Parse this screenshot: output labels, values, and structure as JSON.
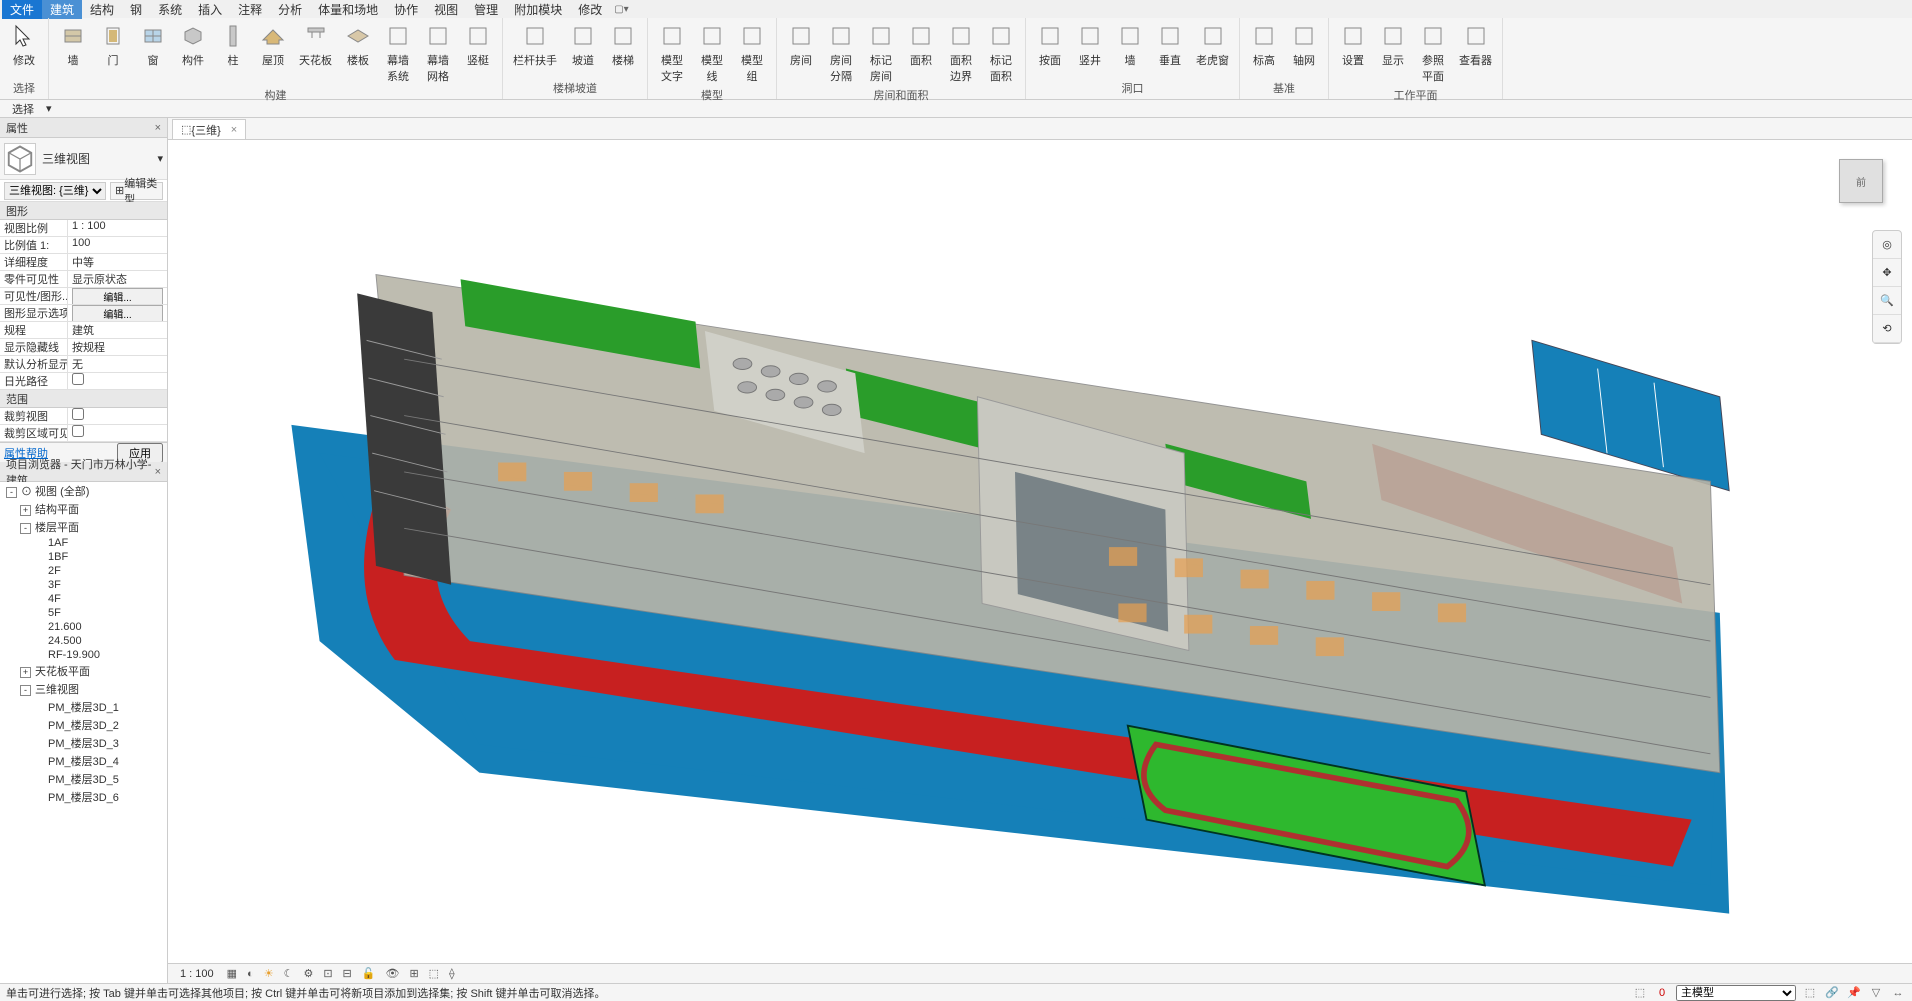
{
  "menu": {
    "items": [
      "文件",
      "建筑",
      "结构",
      "钢",
      "系统",
      "插入",
      "注释",
      "分析",
      "体量和场地",
      "协作",
      "视图",
      "管理",
      "附加模块",
      "修改"
    ],
    "active_index": 1
  },
  "ribbon": {
    "groups": [
      {
        "label": "选择",
        "tools": [
          {
            "icon": "cursor",
            "label": "修改"
          }
        ]
      },
      {
        "label": "构建",
        "tools": [
          {
            "icon": "wall",
            "label": "墙"
          },
          {
            "icon": "door",
            "label": "门"
          },
          {
            "icon": "window",
            "label": "窗"
          },
          {
            "icon": "component",
            "label": "构件"
          },
          {
            "icon": "column",
            "label": "柱"
          },
          {
            "icon": "roof",
            "label": "屋顶"
          },
          {
            "icon": "ceiling",
            "label": "天花板"
          },
          {
            "icon": "floor",
            "label": "楼板"
          },
          {
            "icon": "curtain-sys",
            "label": "幕墙\n系统"
          },
          {
            "icon": "curtain-grid",
            "label": "幕墙\n网格"
          },
          {
            "icon": "mullion",
            "label": "竖梃"
          }
        ]
      },
      {
        "label": "楼梯坡道",
        "tools": [
          {
            "icon": "railing",
            "label": "栏杆扶手"
          },
          {
            "icon": "ramp",
            "label": "坡道"
          },
          {
            "icon": "stair",
            "label": "楼梯"
          }
        ]
      },
      {
        "label": "模型",
        "tools": [
          {
            "icon": "text",
            "label": "模型\n文字"
          },
          {
            "icon": "line",
            "label": "模型\n线"
          },
          {
            "icon": "group",
            "label": "模型\n组"
          }
        ]
      },
      {
        "label": "房间和面积",
        "tools": [
          {
            "icon": "room",
            "label": "房间"
          },
          {
            "icon": "room-sep",
            "label": "房间\n分隔"
          },
          {
            "icon": "tag-room",
            "label": "标记\n房间"
          },
          {
            "icon": "area",
            "label": "面积"
          },
          {
            "icon": "area-bound",
            "label": "面积\n边界"
          },
          {
            "icon": "tag-area",
            "label": "标记\n面积"
          }
        ]
      },
      {
        "label": "洞口",
        "tools": [
          {
            "icon": "by-face",
            "label": "按面"
          },
          {
            "icon": "shaft",
            "label": "竖井"
          },
          {
            "icon": "wall-open",
            "label": "墙"
          },
          {
            "icon": "vertical",
            "label": "垂直"
          },
          {
            "icon": "dormer",
            "label": "老虎窗"
          }
        ]
      },
      {
        "label": "基准",
        "tools": [
          {
            "icon": "level",
            "label": "标高"
          },
          {
            "icon": "grid",
            "label": "轴网"
          }
        ]
      },
      {
        "label": "工作平面",
        "tools": [
          {
            "icon": "set",
            "label": "设置"
          },
          {
            "icon": "show",
            "label": "显示"
          },
          {
            "icon": "ref-plane",
            "label": "参照\n平面"
          },
          {
            "icon": "viewer",
            "label": "查看器"
          }
        ]
      }
    ]
  },
  "subbar": {
    "label": "选择"
  },
  "properties": {
    "title": "属性",
    "type_name": "三维视图",
    "instance_name": "三维视图: {三维}",
    "edit_type_label": "编辑类型",
    "section1": "图形",
    "rows1": [
      {
        "name": "视图比例",
        "value": "1 : 100",
        "type": "select"
      },
      {
        "name": "比例值 1:",
        "value": "100",
        "type": "text"
      },
      {
        "name": "详细程度",
        "value": "中等",
        "type": "text"
      },
      {
        "name": "零件可见性",
        "value": "显示原状态",
        "type": "text"
      },
      {
        "name": "可见性/图形...",
        "value": "编辑...",
        "type": "button"
      },
      {
        "name": "图形显示选项",
        "value": "编辑...",
        "type": "button"
      },
      {
        "name": "规程",
        "value": "建筑",
        "type": "text"
      },
      {
        "name": "显示隐藏线",
        "value": "按规程",
        "type": "text"
      },
      {
        "name": "默认分析显示...",
        "value": "无",
        "type": "text"
      },
      {
        "name": "日光路径",
        "value": "",
        "type": "checkbox"
      }
    ],
    "section2": "范围",
    "rows2": [
      {
        "name": "裁剪视图",
        "value": "",
        "type": "checkbox"
      },
      {
        "name": "裁剪区域可见",
        "value": "",
        "type": "checkbox"
      }
    ],
    "help_link": "属性帮助",
    "apply_btn": "应用"
  },
  "browser": {
    "title": "项目浏览器 - 天门市万林小学-建筑...",
    "root": "视图 (全部)",
    "nodes": [
      {
        "label": "结构平面",
        "level": 1,
        "toggle": "+"
      },
      {
        "label": "楼层平面",
        "level": 1,
        "toggle": "-",
        "children": [
          "1AF",
          "1BF",
          "2F",
          "3F",
          "4F",
          "5F",
          "21.600",
          "24.500",
          "RF-19.900"
        ]
      },
      {
        "label": "天花板平面",
        "level": 1,
        "toggle": "+"
      },
      {
        "label": "三维视图",
        "level": 1,
        "toggle": "-",
        "children": [
          "PM_楼层3D_1",
          "PM_楼层3D_2",
          "PM_楼层3D_3",
          "PM_楼层3D_4",
          "PM_楼层3D_5",
          "PM_楼层3D_6"
        ]
      }
    ]
  },
  "viewport": {
    "tab_icon": "cube",
    "tab_label": "{三维}",
    "viewcube_face": "前",
    "scale": "1 : 100"
  },
  "status": {
    "message": "单击可进行选择; 按 Tab 键并单击可选择其他项目; 按 Ctrl 键并单击可将新项目添加到选择集; 按 Shift 键并单击可取消选择。",
    "model_selector": "主模型",
    "count": "0"
  }
}
